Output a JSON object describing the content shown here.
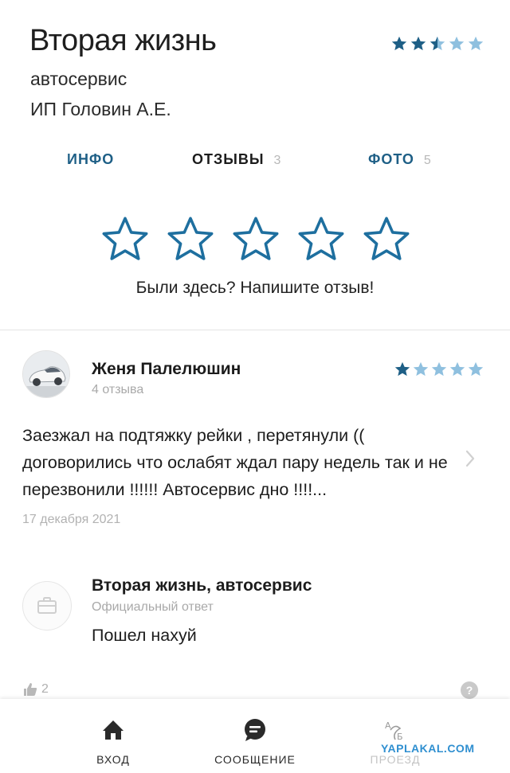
{
  "header": {
    "title": "Вторая жизнь",
    "subtitle": "автосервис",
    "owner": "ИП Головин А.Е.",
    "rating_stars": 2.5
  },
  "tabs": [
    {
      "label": "ИНФО",
      "count": ""
    },
    {
      "label": "ОТЗЫВЫ",
      "count": "3"
    },
    {
      "label": "ФОТО",
      "count": "5"
    }
  ],
  "rate": {
    "prompt": "Были здесь? Напишите отзыв!"
  },
  "review": {
    "author": "Женя Палелюшин",
    "author_reviews": "4 отзыва",
    "rating_stars": 1,
    "text": "Заезжал на подтяжку рейки , перетянули (( договорились что ослабят ждал пару недель так и не перезвонили !!!!!! Автосервис дно !!!!...",
    "date": "17 декабря 2021",
    "likes": "2"
  },
  "reply": {
    "business": "Вторая жизнь, автосервис",
    "label": "Официальный ответ",
    "text": "Пошел нахуй"
  },
  "bottom_nav": {
    "enter": "ВХОД",
    "message": "СООБЩЕНИЕ",
    "route": "ПРОЕЗД"
  },
  "watermark": "YAPLAKAL.COM",
  "colors": {
    "accent": "#1e5f86",
    "star_filled": "#1e5f86",
    "star_empty": "#8fc0df",
    "muted": "#a9a9a9"
  }
}
